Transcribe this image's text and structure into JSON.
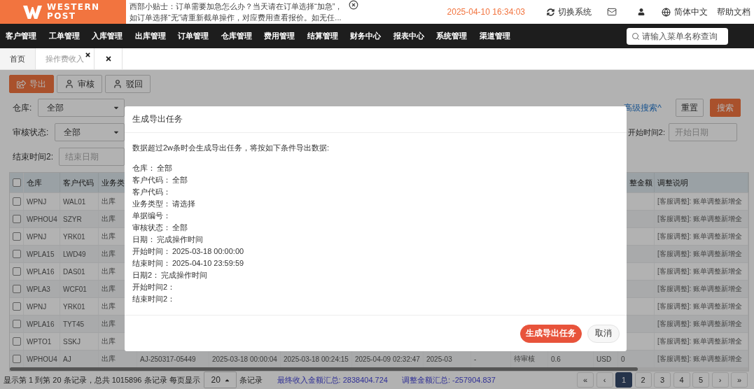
{
  "header": {
    "logo": [
      "WESTERN",
      "POST"
    ],
    "notice": [
      "西部小贴士：订单需要加急怎么办？当天请在订单选择“加急”，",
      "如订单选择“无”请重新截单操作，对应费用查看报价。如无任..."
    ],
    "datetime": "2025-04-10 16:34:03",
    "switch_system": "切换系统",
    "language": "简体中文",
    "help": "帮助文档"
  },
  "nav": {
    "items": [
      "客户管理",
      "工单管理",
      "入库管理",
      "出库管理",
      "订单管理",
      "仓库管理",
      "费用管理",
      "结算管理",
      "财务中心",
      "报表中心",
      "系统管理",
      "渠道管理"
    ],
    "search": {
      "placeholder": "请输入菜单名称查询"
    }
  },
  "tabs": [
    {
      "label": "首页",
      "selected": false,
      "closable": false
    },
    {
      "label": "操作费收入",
      "selected": true,
      "closable": true
    }
  ],
  "toolbar": [
    {
      "label": "导出",
      "kind": "primary"
    },
    {
      "label": "审核",
      "kind": "default"
    },
    {
      "label": "驳回",
      "kind": "default"
    }
  ],
  "filters": {
    "warehouse": {
      "label": "仓库:",
      "value": "全部"
    },
    "advanced_search": "高级搜索^",
    "reset": "重置",
    "search": "搜索",
    "audit_status": {
      "label": "审核状态:",
      "value": "全部"
    },
    "start_time_2": {
      "label": "开始时间2:",
      "placeholder": "开始日期"
    },
    "end_time_2": {
      "label": "结束时间2:",
      "placeholder": "结束日期"
    }
  },
  "table": {
    "all_checked": false,
    "columns": {
      "warehouse": "仓库",
      "customer_code": "客户代码",
      "column_3": "业务类",
      "column_13": "整金额",
      "adjust_note": "调整说明"
    },
    "rows": [
      {
        "checked": false,
        "warehouse": "WPNJ",
        "customer_code": "WAL01",
        "column_3": "出库",
        "adjust_note": "[客服调整]: 账单调整新增全"
      },
      {
        "checked": false,
        "warehouse": "WPHOU4",
        "customer_code": "SZYR",
        "column_3": "出库",
        "adjust_note": "[客服调整]: 账单调整新增全"
      },
      {
        "checked": false,
        "warehouse": "WPNJ",
        "customer_code": "YRK01",
        "column_3": "出库",
        "adjust_note": "[客服调整]: 账单调整新增全"
      },
      {
        "checked": false,
        "warehouse": "WPLA15",
        "customer_code": "LWD49",
        "column_3": "出库",
        "adjust_note": "[客服调整]: 账单调整新增全"
      },
      {
        "checked": false,
        "warehouse": "WPLA16",
        "customer_code": "DAS01",
        "column_3": "出库",
        "adjust_note": "[客服调整]: 账单调整新增全"
      },
      {
        "checked": false,
        "warehouse": "WPLA3",
        "customer_code": "WCF01",
        "column_3": "出库",
        "adjust_note": "[客服调整]: 账单调整新增全"
      },
      {
        "checked": false,
        "warehouse": "WPNJ",
        "customer_code": "YRK01",
        "column_3": "出库",
        "adjust_note": "[客服调整]: 账单调整新增全"
      },
      {
        "checked": false,
        "warehouse": "WPLA16",
        "customer_code": "TYT45",
        "column_3": "出库",
        "adjust_note": "[客服调整]: 账单调整新增全"
      },
      {
        "checked": false,
        "warehouse": "WPTO1",
        "customer_code": "SSKJ",
        "column_3": "出库",
        "adjust_note": "[客服调整]: 账单调整新增全"
      },
      {
        "checked": false,
        "warehouse": "WPHOU4",
        "customer_code": "AJ",
        "column_3": "出库",
        "column_4": "AJ-250317-05449",
        "column_5": "2025-03-18 00:00:04",
        "column_6": "2025-03-18 00:24:15",
        "column_7": "2025-04-09 02:32:47",
        "column_8": "2025-03",
        "column_9": "-",
        "column_10": "待审核",
        "column_11": "0.6",
        "column_12": "USD",
        "column_13": "0",
        "adjust_note": "[客服调整]: 账单调整新增全"
      }
    ]
  },
  "modal": {
    "title": "生成导出任务",
    "intro": "数据超过2w条时会生成导出任务，将按如下条件导出数据:",
    "conditions": [
      {
        "label": "仓库：",
        "value": "全部"
      },
      {
        "label": "客户代码：",
        "value": "全部"
      },
      {
        "label": "客户代码："
      },
      {
        "label": "业务类型：",
        "value": "请选择"
      },
      {
        "label": "单据编号："
      },
      {
        "label": "审核状态：",
        "value": "全部"
      },
      {
        "label": "日期：",
        "value": "完成操作时间"
      },
      {
        "label": "开始时间：",
        "value": "2025-03-18 00:00:00"
      },
      {
        "label": "结束时间：",
        "value": "2025-04-10 23:59:59"
      },
      {
        "label": "日期2：",
        "value": "完成操作时间"
      },
      {
        "label": "开始时间2："
      },
      {
        "label": "结束时间2："
      }
    ],
    "buttons": [
      {
        "label": "生成导出任务",
        "kind": "primary"
      },
      {
        "label": "取消",
        "kind": "default"
      }
    ]
  },
  "footer": {
    "summary": "显示第 1 到第 20 条记录，总共 1015896 条记录 每页显示",
    "page_size": "20",
    "page_size_suffix": "条记录",
    "totals": [
      "最终收入金额汇总: 2838404.724",
      "调整金额汇总: -257904.837"
    ],
    "pages": [
      {
        "label": "«",
        "selected": false
      },
      {
        "label": "‹",
        "selected": false
      },
      {
        "label": "1",
        "selected": true
      },
      {
        "label": "2",
        "selected": false
      },
      {
        "label": "3",
        "selected": false
      },
      {
        "label": "4",
        "selected": false
      },
      {
        "label": "5",
        "selected": false
      },
      {
        "label": "›",
        "selected": false
      },
      {
        "label": "»",
        "selected": false
      }
    ]
  }
}
